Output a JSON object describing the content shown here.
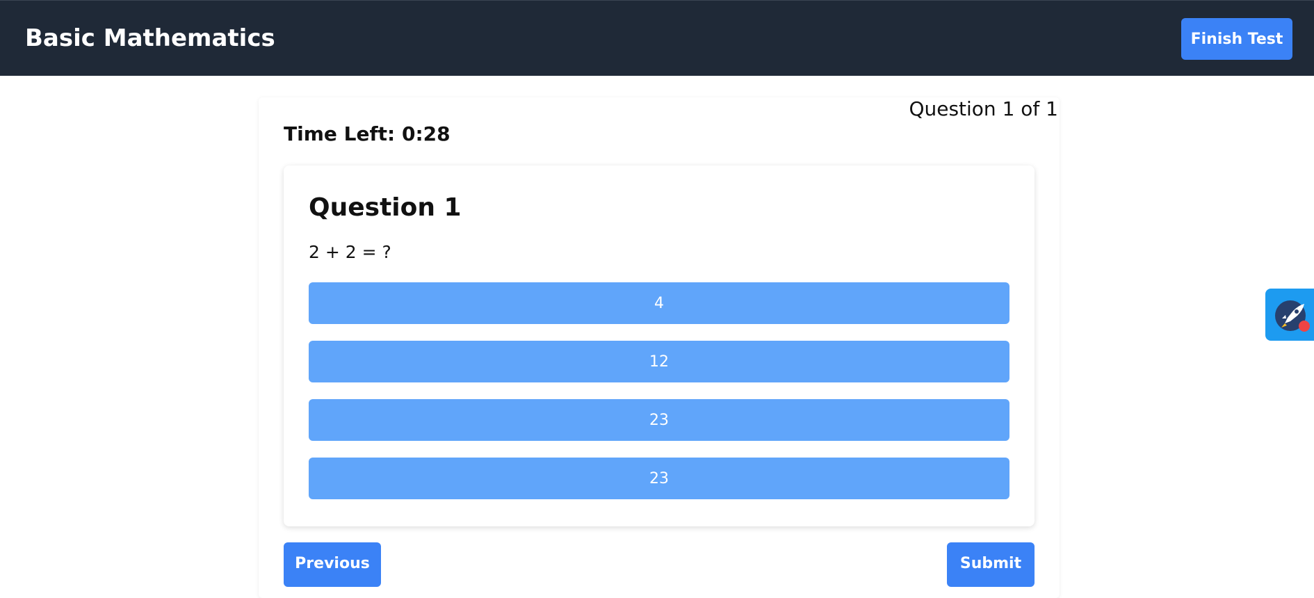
{
  "header": {
    "title": "Basic Mathematics",
    "finish_label": "Finish Test"
  },
  "quiz": {
    "counter": "Question 1 of 1",
    "time_left": "Time Left: 0:28",
    "question_title": "Question 1",
    "question_text": "2 + 2 = ?",
    "options": [
      "4",
      "12",
      "23",
      "23"
    ],
    "previous_label": "Previous",
    "submit_label": "Submit"
  },
  "widget": {
    "icon": "rocket-icon"
  },
  "colors": {
    "header_bg": "#1f2937",
    "primary": "#3b82f6",
    "option_bg": "#60a5fa",
    "widget_bg": "#1d9bf0"
  }
}
